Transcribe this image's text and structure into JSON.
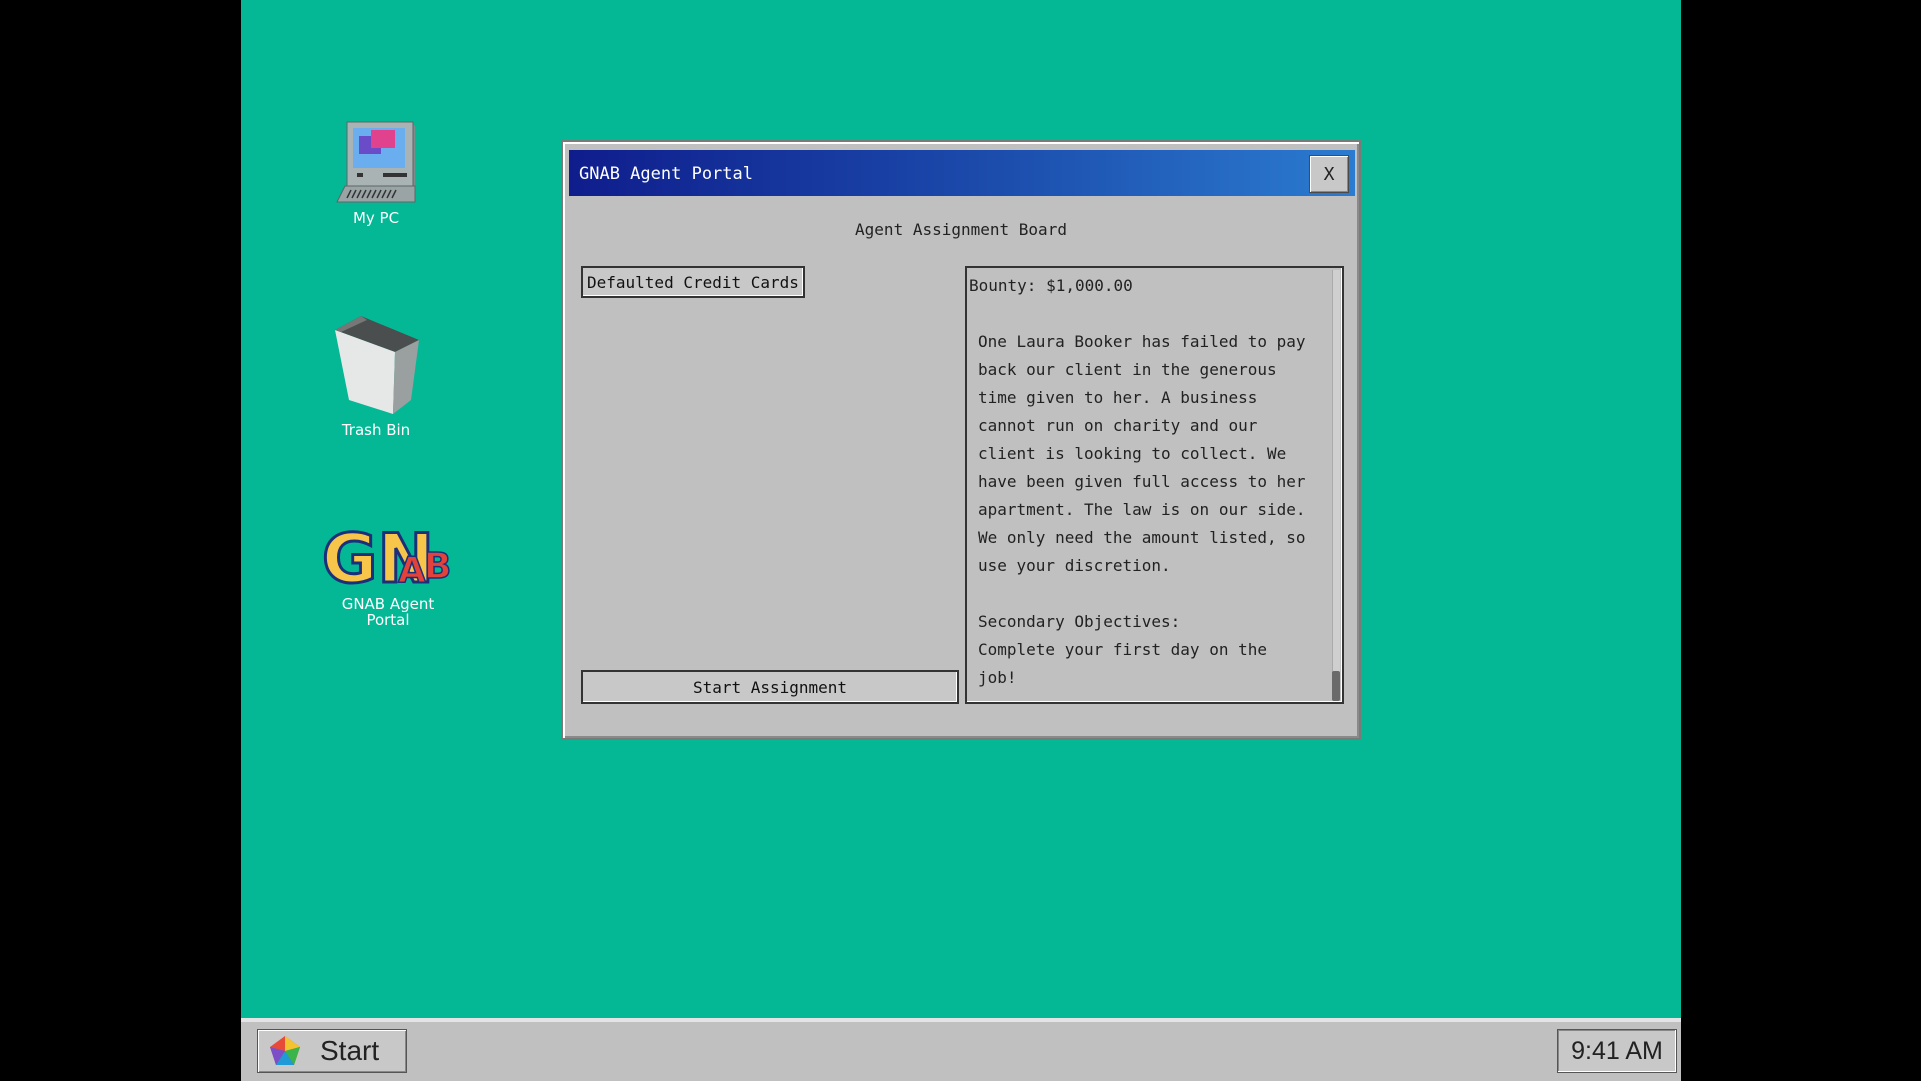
{
  "desktop": {
    "background_color": "#04b896",
    "icons": [
      {
        "label": "My PC",
        "icon": "computer-icon"
      },
      {
        "label": "Trash Bin",
        "icon": "trash-bin-icon"
      },
      {
        "label": "GNAB Agent Portal",
        "icon": "gnab-logo-icon"
      }
    ]
  },
  "window": {
    "title": "GNAB Agent Portal",
    "close_label": "X",
    "board_title": "Agent Assignment Board",
    "assignments": [
      {
        "label": "Defaulted Credit Cards"
      }
    ],
    "start_button_label": "Start Assignment",
    "detail": {
      "bounty": "Bounty: $1,000.00",
      "description_lines": [
        "One Laura Booker has failed to pay",
        "back our client in the generous",
        "time given to her. A business",
        "cannot run on charity and our",
        "client is looking to collect. We",
        "have been given full access to her",
        "apartment. The law is on our side.",
        "We only need the amount listed, so",
        "use your discretion."
      ],
      "secondary_heading": "Secondary Objectives:",
      "secondary_lines": [
        "Complete your first day on the",
        "job!"
      ]
    }
  },
  "taskbar": {
    "start_label": "Start",
    "clock": "9:41 AM"
  }
}
